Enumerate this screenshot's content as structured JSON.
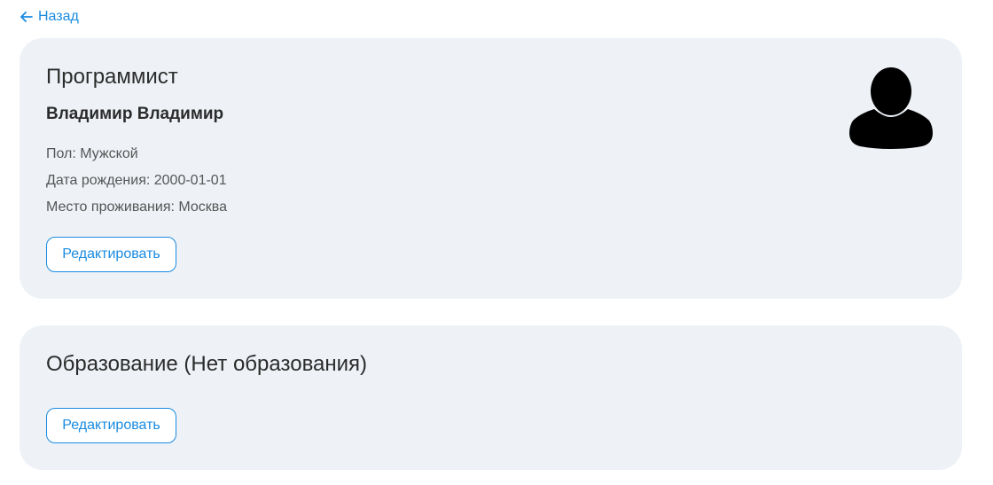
{
  "nav": {
    "back_label": "Назад"
  },
  "profile": {
    "position": "Программист",
    "name": "Владимир Владимир",
    "gender": "Пол: Мужской",
    "birth_date": "Дата рождения: 2000-01-01",
    "city": "Место проживания: Москва",
    "edit_label": "Редактировать",
    "avatar_icon": "user-silhouette-icon"
  },
  "education": {
    "title": "Образование (Нет образования)",
    "edit_label": "Редактировать"
  },
  "colors": {
    "accent": "#1a8be0",
    "card_background": "#eef2f7",
    "text_primary": "#2b2b2b",
    "text_secondary": "#555555"
  }
}
